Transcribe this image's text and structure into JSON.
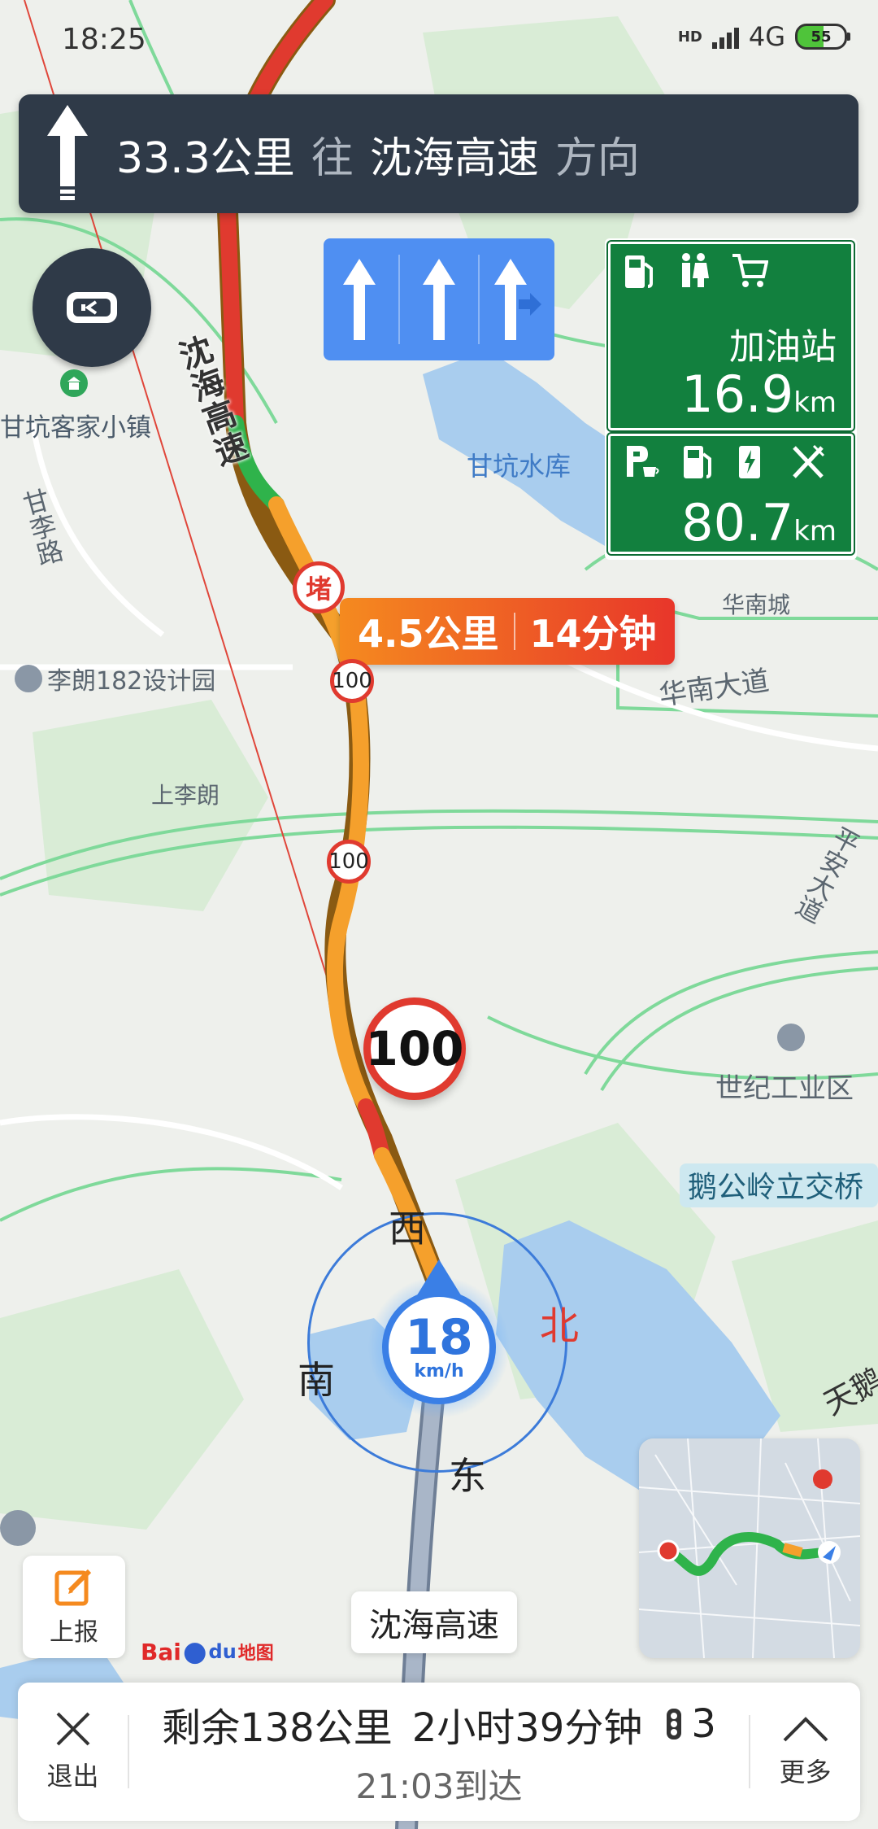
{
  "status": {
    "time": "18:25",
    "network": "4G",
    "hd": "HD",
    "battery": "55"
  },
  "guidance": {
    "distance": "33.3公里",
    "toward": "往",
    "road": "沈海高速",
    "direction": "方向",
    "icon": "straight-arrow-icon"
  },
  "lanes": {
    "count": 3,
    "arrows": [
      "straight",
      "straight",
      "straight-right"
    ]
  },
  "services": {
    "first": {
      "icons": [
        "fuel-icon",
        "restroom-icon",
        "cart-icon"
      ],
      "label": "加油站",
      "distance": "16.9",
      "unit": "km"
    },
    "second": {
      "icons": [
        "parking-cafe-icon",
        "fuel-icon",
        "ev-charging-icon",
        "restaurant-icon"
      ],
      "distance": "80.7",
      "unit": "km"
    }
  },
  "traffic": {
    "badge": "堵",
    "distance": "4.5公里",
    "time": "14分钟"
  },
  "speed_limits": {
    "small": "100",
    "large": "100"
  },
  "compass": {
    "north": "北",
    "south": "南",
    "east": "东",
    "west": "西"
  },
  "current_speed": {
    "value": "18",
    "unit": "km/h"
  },
  "map_labels": {
    "highway_vertical": "沈海高速",
    "ganken_town": "甘坑客家小镇",
    "ganken_reservoir": "甘坑水库",
    "ganli_road": "甘李路",
    "lilang_park": "李朗182设计园",
    "shang_lilang": "上李朗",
    "huanan_city": "华南城",
    "huanan_avenue": "华南大道",
    "century_industrial": "世纪工业区",
    "egongling": "鹅公岭立交桥",
    "right_road_1": "平安大道",
    "right_road_2": "天鹅"
  },
  "controls": {
    "report_label": "上报",
    "logo_left": "Bai",
    "logo_mid": "du",
    "logo_right": "地图",
    "current_road": "沈海高速"
  },
  "trip": {
    "remaining": "剩余138公里",
    "duration": "2小时39分钟",
    "traffic_lights": "3",
    "arrival": "21:03到达",
    "exit_label": "退出",
    "more_label": "更多"
  },
  "colors": {
    "banner": "#2f3a48",
    "lane_bg": "#4f8ff2",
    "service_green": "#12803e",
    "route_orange": "#f5a02c",
    "route_red": "#e03a2f",
    "route_green": "#2fb34b",
    "accent_blue": "#3a7fe6"
  }
}
